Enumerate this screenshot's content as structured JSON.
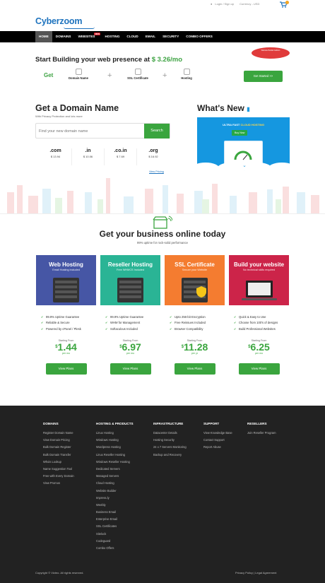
{
  "header": {
    "logo": "Cyberzoom",
    "login": "Login / Sign up",
    "currency": "Currency - USD"
  },
  "nav": {
    "items": [
      "HOME",
      "DOMAINS",
      "WEBSITES",
      "HOSTING",
      "CLOUD",
      "EMAIL",
      "SECURITY",
      "COMBO OFFERS"
    ],
    "new_badge": "NEW"
  },
  "hero": {
    "title": "Start Building your web presence at ",
    "price": "$ 3.26/mo",
    "ribbon": "Website Builder Edition",
    "get": "Get",
    "steps": [
      "Domain Name",
      "SSL Certificate",
      "Hosting"
    ],
    "start_button": "Get Started >>"
  },
  "domain": {
    "title": "Get a Domain Name",
    "subtitle": "With Privacy Protection and lots more",
    "placeholder": "Find your new domain name",
    "search_button": "Search",
    "tlds": [
      {
        "name": ".com",
        "price": "$ 13.94"
      },
      {
        "name": ".in",
        "price": "$ 10.06"
      },
      {
        "name": ".co.in",
        "price": "$ 7.69"
      },
      {
        "name": ".org",
        "price": "$ 16.92"
      }
    ],
    "view_pricing": "View Pricing"
  },
  "whats_new": {
    "title": "What's New",
    "banner_a": "ULTRA FAST ",
    "banner_b": "CLOUD HOSTING",
    "buy": "Buy Now"
  },
  "business": {
    "title": "Get your business online today",
    "subtitle": "99% uptime for rock-solid performance",
    "cards": [
      {
        "title": "Web Hosting",
        "sub": "Email Hosting included",
        "color": "#4656a5",
        "features": [
          "99.9% Uptime Guarantee",
          "Reliable & Secure",
          "Powered by cPanel / Plesk"
        ],
        "from": "Starting From",
        "currency": "$",
        "price": "1.44",
        "per": "per mo",
        "button": "View Plans"
      },
      {
        "title": "Reseller Hosting",
        "sub": "Free WHMCS Included",
        "color": "#2ab495",
        "features": [
          "99.9% Uptime Guarantee",
          "WHM for Management",
          "Softaculous Included"
        ],
        "from": "Starting From",
        "currency": "$",
        "price": "6.97",
        "per": "per mo",
        "button": "View Plans"
      },
      {
        "title": "SSL Certificate",
        "sub": "Secure your Website",
        "color": "#f47c30",
        "features": [
          "Upto 256-bit Encryption",
          "Free Reissues Included",
          "Browser Compatibility"
        ],
        "from": "Starting From",
        "currency": "$",
        "price": "11.28",
        "per": "per yr",
        "button": "View Plans"
      },
      {
        "title": "Build your website",
        "sub": "No technical skills required",
        "color": "#cc2449",
        "features": [
          "Quick & Easy to Use",
          "Choose from 100's of designs",
          "Build Professional Websites"
        ],
        "from": "Starting From",
        "currency": "$",
        "price": "6.25",
        "per": "per mo",
        "button": "View Plans"
      }
    ]
  },
  "footer": {
    "columns": [
      {
        "heading": "DOMAINS",
        "links": [
          "Register Domain Name",
          "View Domain Pricing",
          "Bulk Domain Register",
          "Bulk Domain Transfer",
          "Whois Lookup",
          "Name Suggestion Tool",
          "Free with Every Domain",
          "View Promos"
        ]
      },
      {
        "heading": "HOSTING & PRODUCTS",
        "links": [
          "Linux Hosting",
          "Windows Hosting",
          "Wordpress Hosting",
          "Linux Reseller Hosting",
          "Windows Reseller Hosting",
          "Dedicated Servers",
          "Managed Servers",
          "Cloud Hosting",
          "Website Builder",
          "Impress.ly",
          "Weebly",
          "Business Email",
          "Enterprise Email",
          "SSL Certificates",
          "Sitelock",
          "Codeguard",
          "Combo Offers"
        ]
      },
      {
        "heading": "INFRASTRUCTURE",
        "links": [
          "Datacenter Details",
          "Hosting Security",
          "24 x 7 Servers Monitoring",
          "Backup and Recovery"
        ]
      },
      {
        "heading": "SUPPORT",
        "links": [
          "View Knowledge Base",
          "Contact Support",
          "Report Abuse"
        ]
      },
      {
        "heading": "RESELLERS",
        "links": [
          "Join Reseller Program"
        ]
      }
    ],
    "copyright": "Copyright © Vizteo. All rights reserved.",
    "policy": "Privacy Policy | Legal Agreement"
  }
}
